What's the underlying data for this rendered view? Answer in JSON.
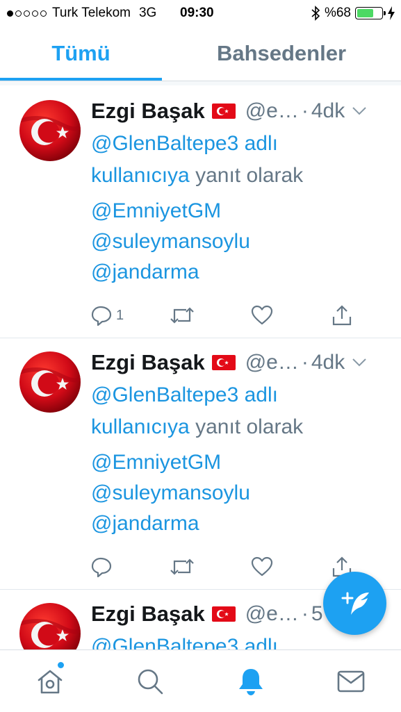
{
  "status_bar": {
    "carrier": "Turk Telekom",
    "network": "3G",
    "time": "09:30",
    "battery_text": "%68",
    "battery_level": 0.68,
    "signal_bars_filled": 1,
    "signal_bars_total": 5,
    "icons": [
      "bluetooth-icon",
      "charging-bolt-icon"
    ]
  },
  "tabs": [
    {
      "label": "Tümü",
      "active": true
    },
    {
      "label": "Bahsedenler",
      "active": false
    }
  ],
  "tweets": [
    {
      "name": "Ezgi Başak",
      "flag": "🇹🇷",
      "handle": "@e…",
      "separator": "·",
      "time": "4dk",
      "reply_to_handle": "@GlenBaltepe3 adlı",
      "reply_to_word": "kullanıcıya",
      "reply_suffix": "yanıt olarak",
      "mentions": [
        "@EmniyetGM",
        "@suleymansoylu",
        "@jandarma"
      ],
      "reply_count": "1"
    },
    {
      "name": "Ezgi Başak",
      "flag": "🇹🇷",
      "handle": "@e…",
      "separator": "·",
      "time": "4dk",
      "reply_to_handle": "@GlenBaltepe3 adlı",
      "reply_to_word": "kullanıcıya",
      "reply_suffix": "yanıt olarak",
      "mentions": [
        "@EmniyetGM",
        "@suleymansoylu",
        "@jandarma"
      ],
      "reply_count": ""
    },
    {
      "name": "Ezgi Başak",
      "flag": "🇹🇷",
      "handle": "@e…",
      "separator": "·",
      "time": "5",
      "reply_to_handle": "@GlenBaltepe3 adlı"
    }
  ],
  "bottom_nav": [
    "home-icon",
    "search-icon",
    "notifications-bell-icon",
    "messages-envelope-icon"
  ],
  "colors": {
    "accent": "#1da1f2",
    "link": "#1b95e0",
    "secondary_text": "#657786",
    "battery": "#4cd964",
    "flag_red": "#e30a17"
  }
}
